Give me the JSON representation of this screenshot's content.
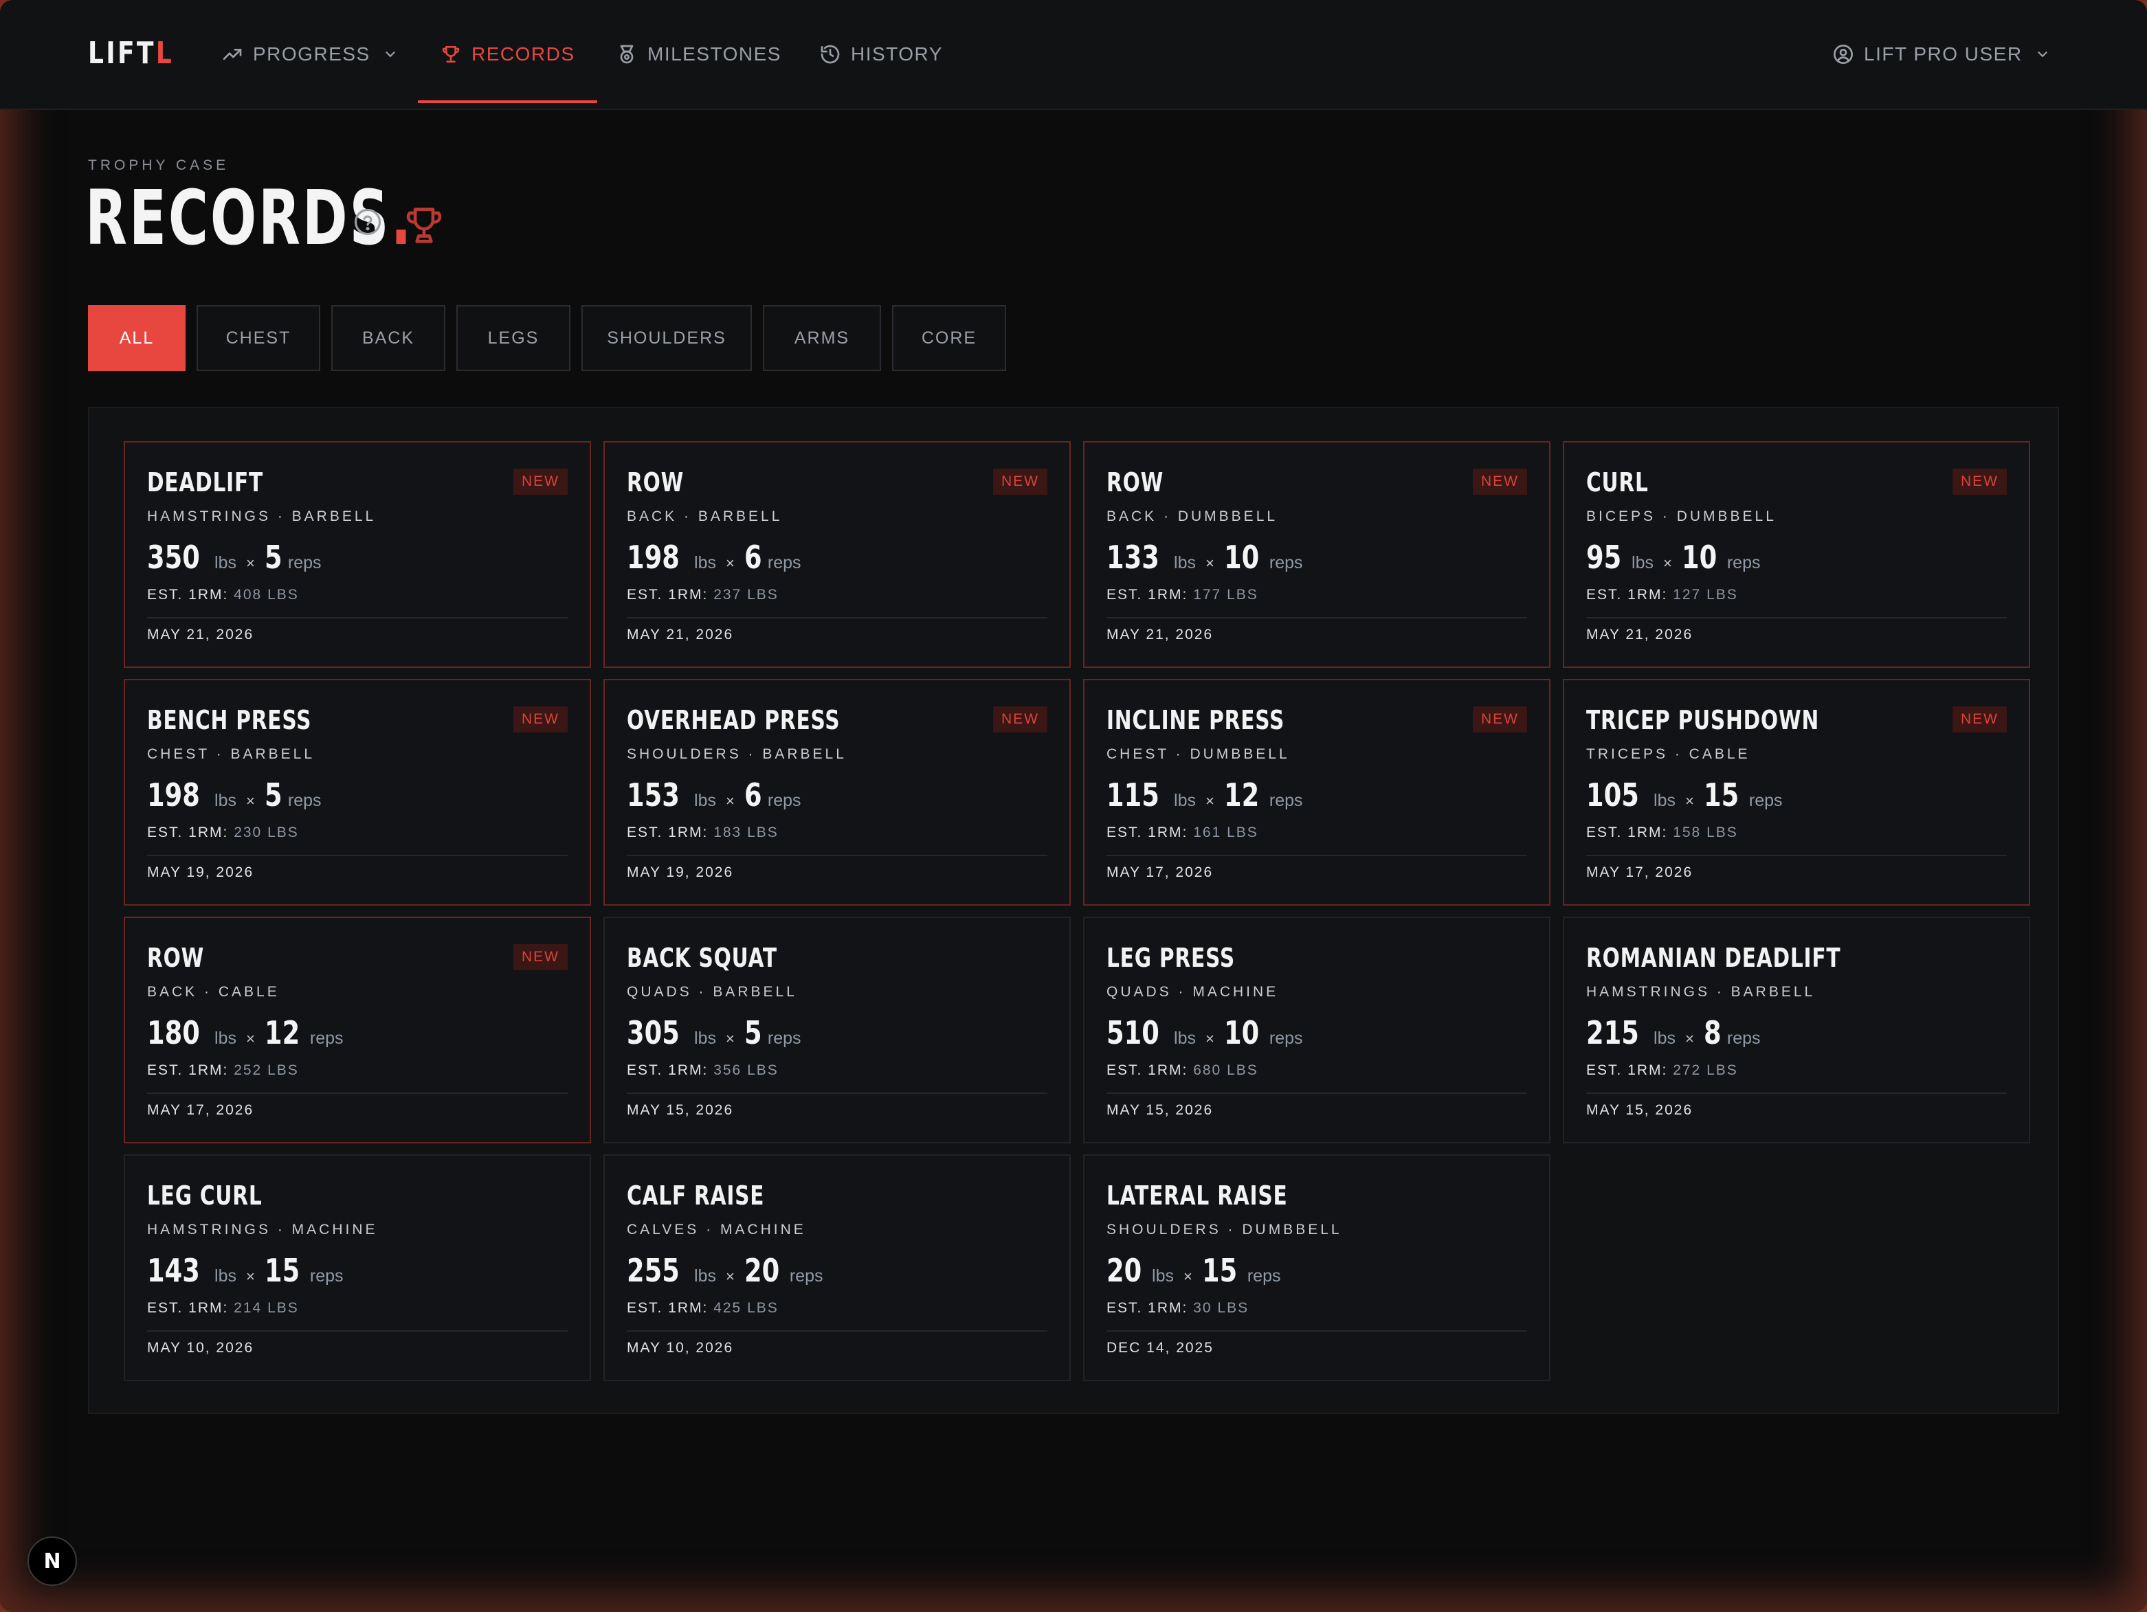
{
  "nav": {
    "logo_main": "LIFT",
    "logo_accent": "L",
    "items": [
      {
        "label": "PROGRESS",
        "icon": "trending-up-icon",
        "has_dropdown": true
      },
      {
        "label": "RECORDS",
        "icon": "trophy-icon",
        "active": true
      },
      {
        "label": "MILESTONES",
        "icon": "medal-icon"
      },
      {
        "label": "HISTORY",
        "icon": "history-icon"
      }
    ],
    "user_label": "LIFT PRO USER"
  },
  "header": {
    "eyebrow": "TROPHY CASE",
    "title": "RECORDS",
    "title_dot": "."
  },
  "filters": [
    "ALL",
    "CHEST",
    "BACK",
    "LEGS",
    "SHOULDERS",
    "ARMS",
    "CORE"
  ],
  "active_filter": "ALL",
  "colors": {
    "accent": "#e8473f",
    "background": "#0c0c0d",
    "card": "#121316"
  },
  "labels": {
    "unit_weight": "lbs",
    "unit_reps": "reps",
    "times": "×",
    "est_prefix": "EST. 1RM:",
    "badge": "NEW"
  },
  "records": [
    {
      "name": "DEADLIFT",
      "sub": "HAMSTRINGS · BARBELL",
      "weight": "350",
      "reps": "5",
      "est": "408 LBS",
      "date": "MAY 21, 2026",
      "is_new": true
    },
    {
      "name": "ROW",
      "sub": "BACK · BARBELL",
      "weight": "198",
      "reps": "6",
      "est": "237 LBS",
      "date": "MAY 21, 2026",
      "is_new": true
    },
    {
      "name": "ROW",
      "sub": "BACK · DUMBBELL",
      "weight": "133",
      "reps": "10",
      "est": "177 LBS",
      "date": "MAY 21, 2026",
      "is_new": true
    },
    {
      "name": "CURL",
      "sub": "BICEPS · DUMBBELL",
      "weight": "95",
      "reps": "10",
      "est": "127 LBS",
      "date": "MAY 21, 2026",
      "is_new": true
    },
    {
      "name": "BENCH PRESS",
      "sub": "CHEST · BARBELL",
      "weight": "198",
      "reps": "5",
      "est": "230 LBS",
      "date": "MAY 19, 2026",
      "is_new": true
    },
    {
      "name": "OVERHEAD PRESS",
      "sub": "SHOULDERS · BARBELL",
      "weight": "153",
      "reps": "6",
      "est": "183 LBS",
      "date": "MAY 19, 2026",
      "is_new": true
    },
    {
      "name": "INCLINE PRESS",
      "sub": "CHEST · DUMBBELL",
      "weight": "115",
      "reps": "12",
      "est": "161 LBS",
      "date": "MAY 17, 2026",
      "is_new": true
    },
    {
      "name": "TRICEP PUSHDOWN",
      "sub": "TRICEPS · CABLE",
      "weight": "105",
      "reps": "15",
      "est": "158 LBS",
      "date": "MAY 17, 2026",
      "is_new": true
    },
    {
      "name": "ROW",
      "sub": "BACK · CABLE",
      "weight": "180",
      "reps": "12",
      "est": "252 LBS",
      "date": "MAY 17, 2026",
      "is_new": true
    },
    {
      "name": "BACK SQUAT",
      "sub": "QUADS · BARBELL",
      "weight": "305",
      "reps": "5",
      "est": "356 LBS",
      "date": "MAY 15, 2026",
      "is_new": false
    },
    {
      "name": "LEG PRESS",
      "sub": "QUADS · MACHINE",
      "weight": "510",
      "reps": "10",
      "est": "680 LBS",
      "date": "MAY 15, 2026",
      "is_new": false
    },
    {
      "name": "ROMANIAN DEADLIFT",
      "sub": "HAMSTRINGS · BARBELL",
      "weight": "215",
      "reps": "8",
      "est": "272 LBS",
      "date": "MAY 15, 2026",
      "is_new": false
    },
    {
      "name": "LEG CURL",
      "sub": "HAMSTRINGS · MACHINE",
      "weight": "143",
      "reps": "15",
      "est": "214 LBS",
      "date": "MAY 10, 2026",
      "is_new": false
    },
    {
      "name": "CALF RAISE",
      "sub": "CALVES · MACHINE",
      "weight": "255",
      "reps": "20",
      "est": "425 LBS",
      "date": "MAY 10, 2026",
      "is_new": false
    },
    {
      "name": "LATERAL RAISE",
      "sub": "SHOULDERS · DUMBBELL",
      "weight": "20",
      "reps": "15",
      "est": "30 LBS",
      "date": "DEC 14, 2025",
      "is_new": false
    }
  ],
  "dev_badge": "N"
}
